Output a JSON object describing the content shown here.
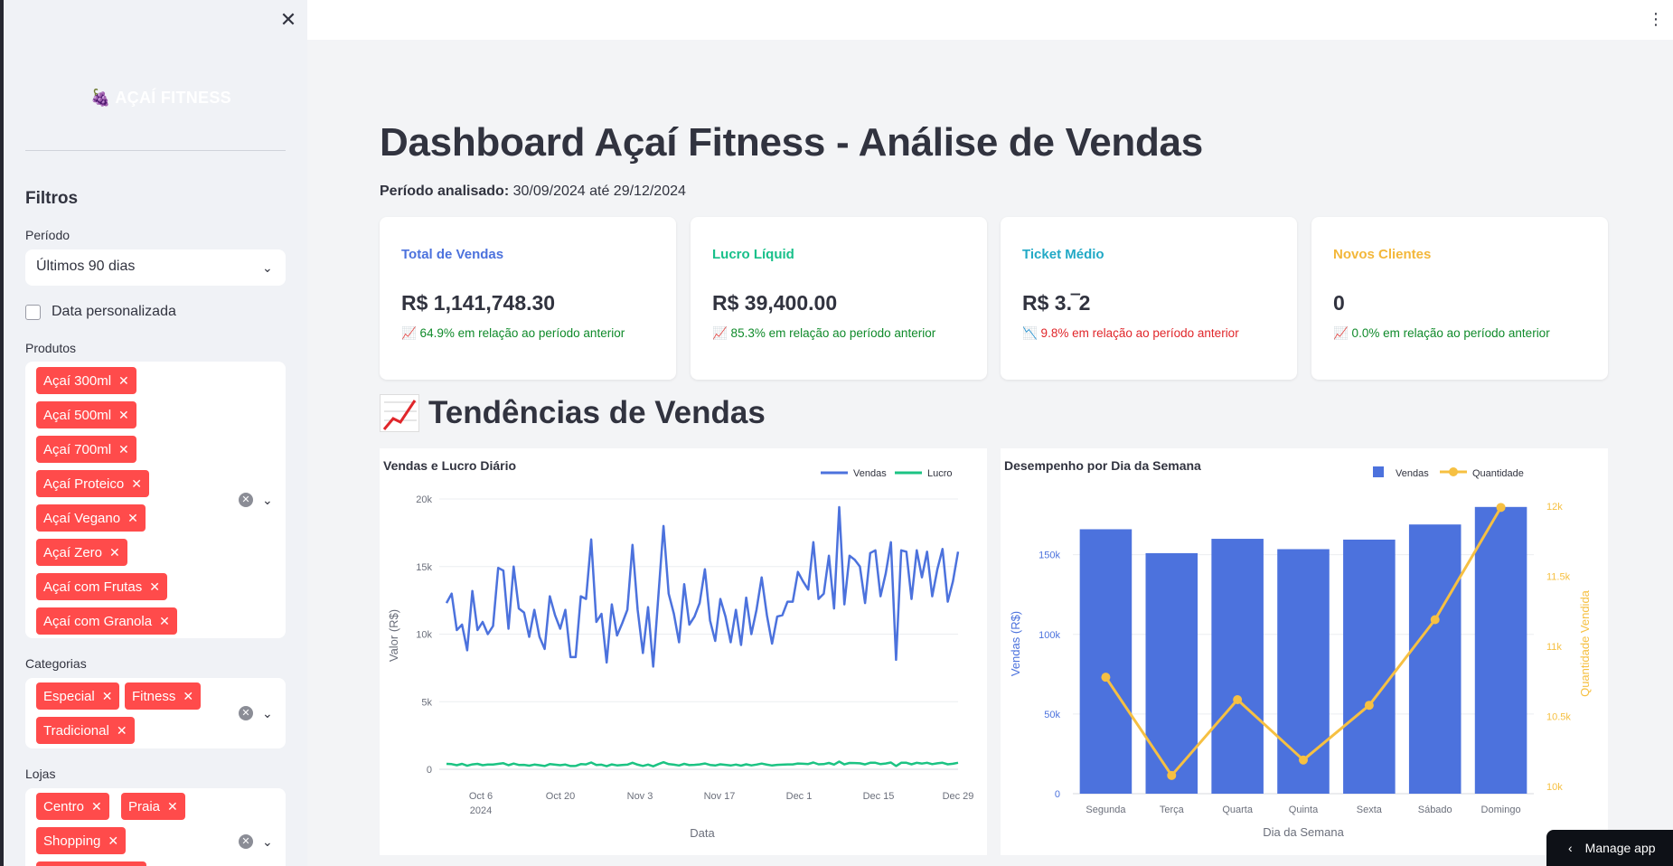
{
  "sidebar": {
    "close_icon": "close-icon",
    "logo_text": "AÇAÍ FITNESS",
    "logo_icon": "🍇",
    "heading": "Filtros",
    "periodo": {
      "label": "Período",
      "value": "Últimos 90 dias"
    },
    "custom_date_label": "Data personalizada",
    "produtos": {
      "label": "Produtos",
      "tags": [
        "Açaí 300ml",
        "Açaí 500ml",
        "Açaí 700ml",
        "Açaí Proteico",
        "Açaí Vegano",
        "Açaí Zero",
        "Açaí com Frutas",
        "Açaí com Granola"
      ]
    },
    "categorias": {
      "label": "Categorias",
      "tags": [
        "Especial",
        "Fitness",
        "Tradicional"
      ]
    },
    "lojas": {
      "label": "Lojas",
      "tags": [
        "Centro",
        "Praia",
        "Shopping"
      ]
    }
  },
  "header": {
    "title": "Dashboard Açaí Fitness - Análise de Vendas",
    "period_label": "Período analisado:",
    "period_value": "30/09/2024 até 29/12/2024"
  },
  "kpis": [
    {
      "title": "Total de Vendas",
      "value": "R$ 1,141,748.30",
      "delta": "📈 64.9% em relação ao período anterior",
      "title_color": "#4c72dd",
      "delta_color": "#0f8a2a"
    },
    {
      "title": "Lucro Líquid",
      "value": "R$ 39,400.00",
      "delta": "📈 85.3% em relação ao período anterior",
      "title_color": "#18c08a",
      "delta_color": "#0f8a2a"
    },
    {
      "title": "Ticket Médio",
      "value": "R$ 3.‾2",
      "delta": "📉 9.8% em relação ao período anterior",
      "title_color": "#22a9c6",
      "delta_color": "#e0262a"
    },
    {
      "title": "Novos Clientes",
      "value": "0",
      "delta": "📈 0.0% em relação ao período anterior",
      "title_color": "#f3b73a",
      "delta_color": "#0f8a2a"
    }
  ],
  "section_title": "Tendências de Vendas",
  "manage_app": "Manage app",
  "chart_data": [
    {
      "type": "line",
      "title": "Vendas e Lucro Diário",
      "xlabel": "Data",
      "ylabel": "Valor (R$)",
      "ylim": [
        0,
        20000
      ],
      "yticks": [
        "0",
        "5k",
        "10k",
        "15k",
        "20k"
      ],
      "xticks": [
        "Oct 6\n2024",
        "Oct 20",
        "Nov 3",
        "Nov 17",
        "Dec 1",
        "Dec 15",
        "Dec 29"
      ],
      "legend": "top-right",
      "grid": true,
      "series": [
        {
          "name": "Vendas",
          "color": "#4c72dd",
          "values": [
            12300,
            13000,
            10300,
            10700,
            8800,
            13200,
            10300,
            10900,
            10000,
            10600,
            14900,
            14700,
            10400,
            15000,
            11900,
            11600,
            9800,
            11800,
            9800,
            8900,
            12800,
            11400,
            10400,
            11800,
            8300,
            8300,
            12800,
            12600,
            17000,
            10900,
            11500,
            7900,
            12200,
            9900,
            10800,
            11800,
            16600,
            11800,
            8600,
            12000,
            7600,
            12800,
            18000,
            13000,
            11500,
            9400,
            13700,
            10700,
            11300,
            12300,
            14800,
            11000,
            9500,
            12600,
            11300,
            9400,
            11800,
            9200,
            12700,
            10000,
            11800,
            14200,
            11400,
            9300,
            11300,
            11400,
            12400,
            12400,
            14600,
            13900,
            13300,
            16800,
            12600,
            13000,
            15800,
            11900,
            19400,
            12200,
            15800,
            15500,
            15000,
            12300,
            16000,
            16200,
            12800,
            14500,
            16800,
            8100,
            16200,
            16100,
            12600,
            16200,
            14200,
            16100,
            12800,
            14800,
            16300,
            12400,
            13900,
            16100
          ]
        },
        {
          "name": "Lucro",
          "color": "#1cc383",
          "values": [
            400,
            380,
            300,
            400,
            260,
            360,
            400,
            300,
            350,
            350,
            400,
            450,
            300,
            420,
            320,
            330,
            270,
            350,
            300,
            240,
            380,
            340,
            300,
            350,
            240,
            250,
            380,
            360,
            500,
            320,
            340,
            230,
            360,
            290,
            320,
            340,
            480,
            340,
            250,
            350,
            220,
            380,
            520,
            380,
            340,
            280,
            400,
            310,
            330,
            360,
            430,
            320,
            280,
            370,
            330,
            280,
            350,
            270,
            370,
            290,
            350,
            420,
            340,
            280,
            330,
            340,
            360,
            360,
            430,
            410,
            390,
            500,
            370,
            380,
            470,
            350,
            570,
            360,
            470,
            460,
            440,
            360,
            480,
            480,
            380,
            430,
            500,
            240,
            480,
            480,
            370,
            480,
            420,
            480,
            380,
            440,
            480,
            370,
            410,
            480
          ]
        }
      ]
    },
    {
      "type": "bar",
      "title": "Desempenho por Dia da Semana",
      "xlabel": "Dia da Semana",
      "ylabel": "Vendas (R$)",
      "y2label": "Quantidade Vendida",
      "categories": [
        "Segunda",
        "Terça",
        "Quarta",
        "Quinta",
        "Sexta",
        "Sábado",
        "Domingo"
      ],
      "ylim": [
        0,
        185000
      ],
      "yticks": [
        "0",
        "50k",
        "100k",
        "150k"
      ],
      "y2lim": [
        9950,
        12050
      ],
      "y2ticks": [
        "10k",
        "10.5k",
        "11k",
        "11.5k",
        "12k"
      ],
      "legend": "top-right",
      "grid": true,
      "series": [
        {
          "name": "Vendas",
          "color": "#4c72dd",
          "values": [
            166000,
            151000,
            160000,
            153500,
            159500,
            169000,
            180000
          ]
        },
        {
          "name": "Quantidade",
          "color": "#f6c042",
          "values": [
            10780,
            10080,
            10620,
            10190,
            10580,
            11190,
            11990
          ]
        }
      ]
    }
  ]
}
